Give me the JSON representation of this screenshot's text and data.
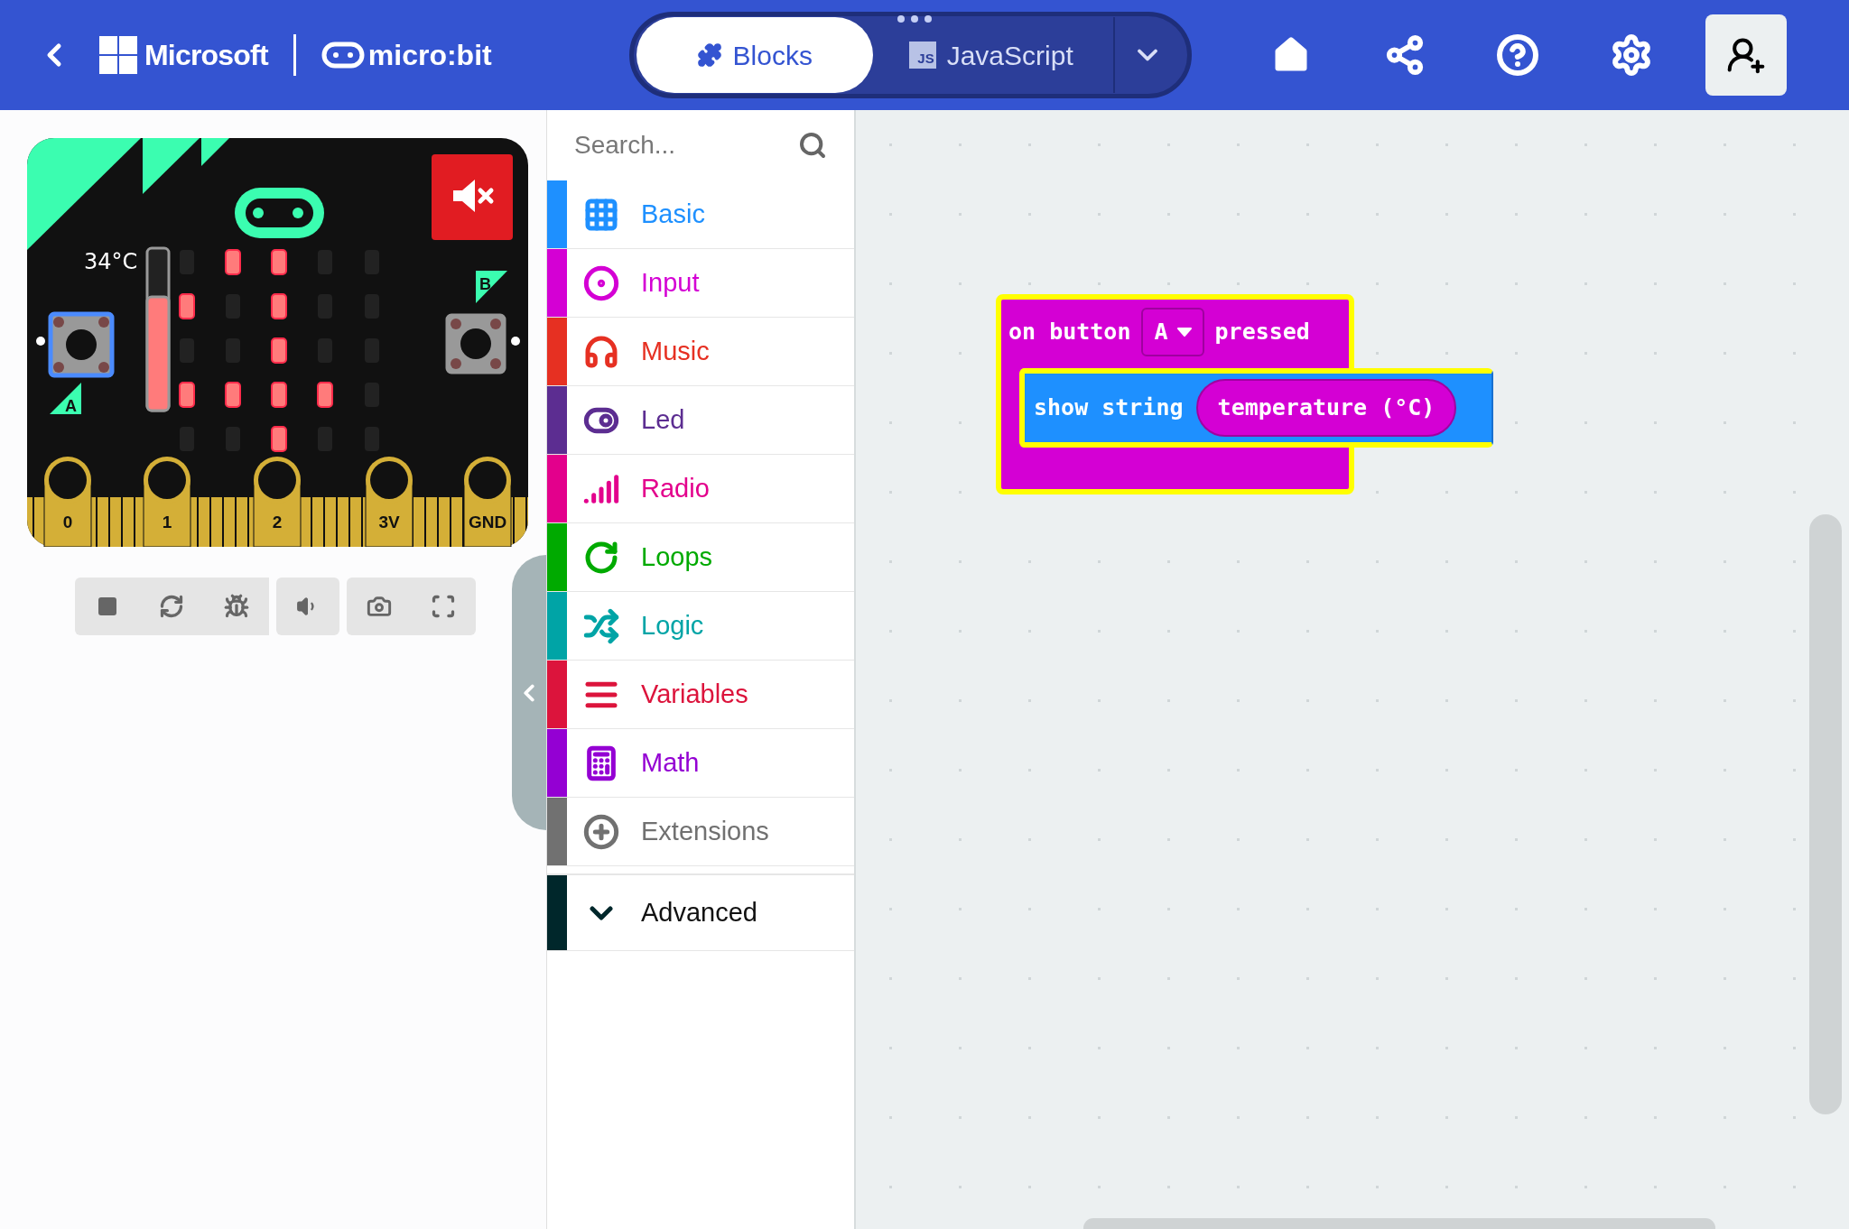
{
  "header": {
    "brand": "Microsoft",
    "product": "micro:bit",
    "tabs": [
      {
        "label": "Blocks",
        "selected": true
      },
      {
        "label": "JavaScript",
        "badge": "JS",
        "selected": false
      }
    ]
  },
  "simulator": {
    "temperature": "34°C",
    "temperature_slider": {
      "level": 0.7
    },
    "muted": true,
    "leds": [
      [
        false,
        true,
        true,
        false,
        false
      ],
      [
        true,
        false,
        true,
        false,
        false
      ],
      [
        false,
        false,
        true,
        false,
        false
      ],
      [
        true,
        true,
        true,
        true,
        false
      ],
      [
        false,
        false,
        true,
        false,
        false
      ]
    ],
    "buttons": [
      {
        "label": "A",
        "selected": true
      },
      {
        "label": "B",
        "selected": false
      }
    ],
    "pins": [
      "0",
      "1",
      "2",
      "3V",
      "GND"
    ]
  },
  "toolbox": {
    "search": {
      "placeholder": "Search..."
    },
    "categories": [
      {
        "label": "Basic",
        "color": "#1e90ff"
      },
      {
        "label": "Input",
        "color": "#d400d4"
      },
      {
        "label": "Music",
        "color": "#e63022"
      },
      {
        "label": "Led",
        "color": "#5c2d91"
      },
      {
        "label": "Radio",
        "color": "#e3008c"
      },
      {
        "label": "Loops",
        "color": "#00aa00"
      },
      {
        "label": "Logic",
        "color": "#00a4a6"
      },
      {
        "label": "Variables",
        "color": "#dc143c"
      },
      {
        "label": "Math",
        "color": "#9400d3"
      },
      {
        "label": "Extensions",
        "color": "#717171"
      }
    ],
    "advanced": {
      "label": "Advanced",
      "color": "#00272b",
      "expanded": false
    }
  },
  "workspace": {
    "event_block": {
      "prefix": "on button",
      "dropdown": "A",
      "suffix": "pressed",
      "statement": {
        "label": "show string",
        "value": "temperature (°C)"
      }
    }
  }
}
